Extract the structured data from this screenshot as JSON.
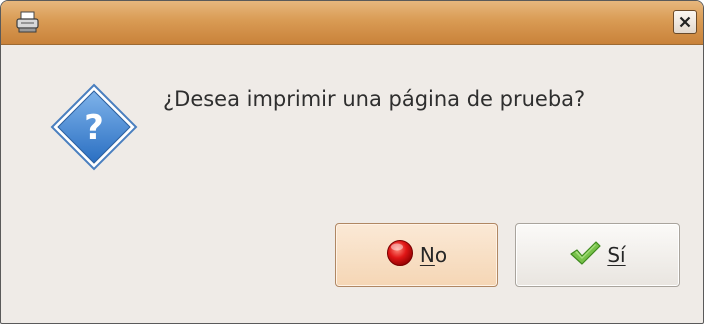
{
  "window": {
    "title": ""
  },
  "dialog": {
    "message": "¿Desea imprimir una página de prueba?",
    "icon": "question-icon"
  },
  "buttons": {
    "no": {
      "mnemonic": "N",
      "rest": "o",
      "icon": "red-stop-icon"
    },
    "si": {
      "mnemonic": "Sí",
      "rest": "",
      "icon": "green-check-icon"
    }
  },
  "colors": {
    "titlebar": "#d99b54",
    "background": "#efebe7",
    "no_button": "#f5d6b5"
  }
}
